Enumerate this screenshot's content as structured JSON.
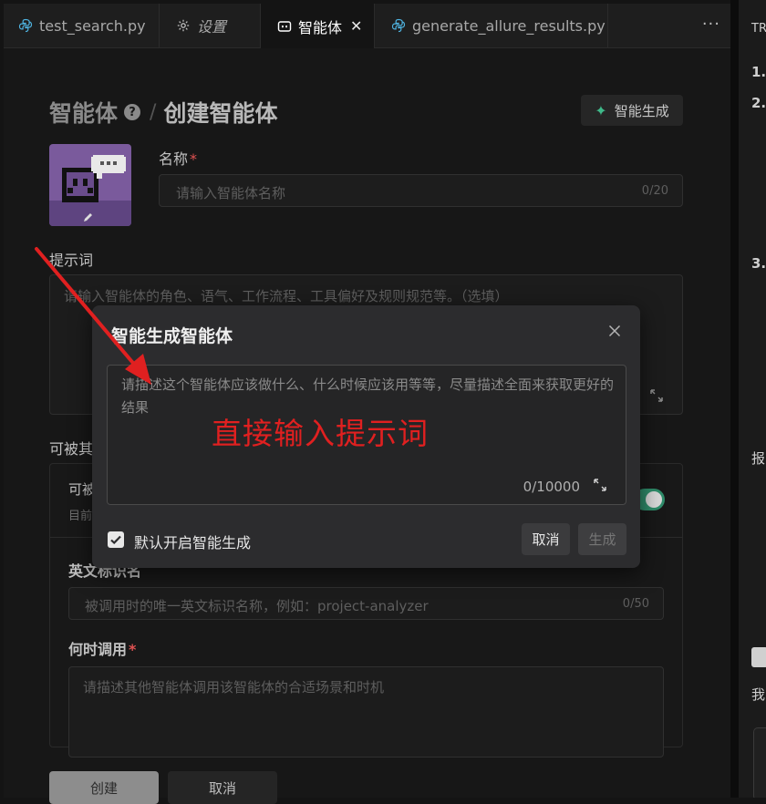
{
  "tabs": [
    {
      "label": "test_search.py",
      "icon": "python-icon",
      "active": false
    },
    {
      "label": "设置",
      "icon": "gear-icon",
      "active": false
    },
    {
      "label": "智能体",
      "icon": "agent-icon",
      "active": true,
      "close": "✕"
    },
    {
      "label": "generate_allure_results.py",
      "icon": "python-icon",
      "active": false
    }
  ],
  "tab_more": "···",
  "header": {
    "agent_label": "智能体",
    "help": "?",
    "separator": "/",
    "title": "创建智能体"
  },
  "smart_generate_button": "智能生成",
  "form": {
    "name_label": "名称",
    "required_mark": "*",
    "name_placeholder": "请输入智能体名称",
    "name_count": "0/20",
    "prompt_label": "提示词",
    "prompt_placeholder": "请输入智能体的角色、语气、工作流程、工具偏好及规则规范等。（选填）",
    "callable_label": "可被其",
    "callable_card_title": "可被",
    "callable_card_desc": "目前",
    "toggle_on": true,
    "en_id_label": "英文标识名",
    "en_id_placeholder": "被调用时的唯一英文标识名称，例如：project-analyzer",
    "en_id_count": "0/50",
    "when_label": "何时调用",
    "when_placeholder": "请描述其他智能体调用该智能体的合适场景和时机",
    "create_button": "创建",
    "cancel_button": "取消"
  },
  "dialog": {
    "title": "智能生成智能体",
    "textarea_placeholder": "请描述这个智能体应该做什么、什么时候应该用等等，尽量描述全面来获取更好的结果",
    "count": "0/10000",
    "checkbox_label": "默认开启智能生成",
    "checkbox_checked": true,
    "cancel_button": "取消",
    "generate_button": "生成"
  },
  "annotation": {
    "text": "直接输入提示词",
    "color": "#e02020"
  },
  "right_panel": {
    "lines": [
      "TR",
      "1.",
      "2.",
      "3.",
      "报",
      "我"
    ]
  },
  "colors": {
    "accent_green": "#3fb98a",
    "toggle_green": "#2f8c6a",
    "required_red": "#e05252"
  }
}
